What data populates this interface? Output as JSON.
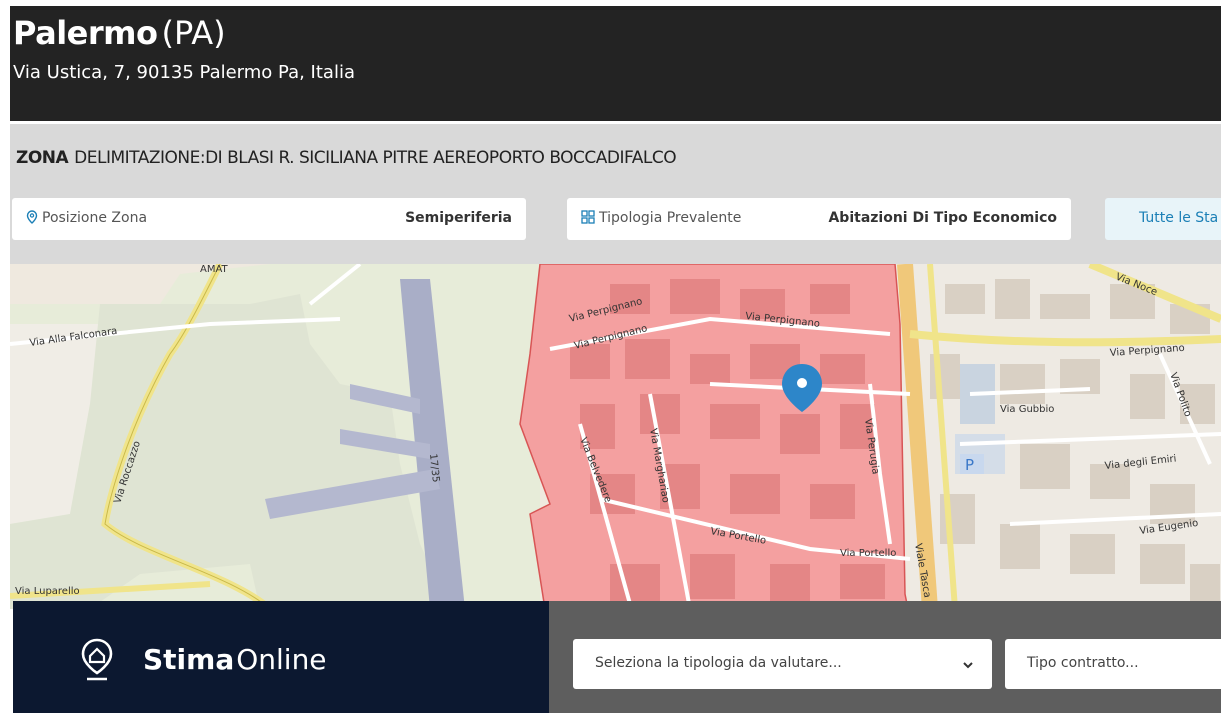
{
  "header": {
    "city": "Palermo",
    "province": "(PA)",
    "address": "Via Ustica, 7, 90135 Palermo Pa, Italia"
  },
  "zone": {
    "label": "ZONA",
    "description": "DELIMITAZIONE:DI BLASI R. SICILIANA PITRE AEREOPORTO BOCCADIFALCO",
    "position": {
      "label": "Posizione Zona",
      "value": "Semiperiferia",
      "icon": "map-pin-icon"
    },
    "typology": {
      "label": "Tipologia Prevalente",
      "value": "Abitazioni Di Tipo Economico",
      "icon": "grid-icon"
    },
    "all_stats_button": "Tutte le Sta"
  },
  "map": {
    "streets": [
      "Via Alla Falconara",
      "Via Roccazzo",
      "Via Luparello",
      "Via Perpignano",
      "Via Perpignano",
      "Via Perpignano",
      "Via Belvedere",
      "Via Marghariao",
      "Via Portello",
      "Via Portello",
      "Via Perpignano",
      "Via Gubbio",
      "Via degli Emiri",
      "Via Eugenio",
      "Viale Tasca",
      "Via Noce",
      "Via Polito",
      "Via Perugia",
      "AMAT",
      "17/35"
    ],
    "zone_highlight_color": "#f4a0a0",
    "marker_color": "#2d86c9",
    "parking_label": "P"
  },
  "stima": {
    "bold": "Stima",
    "light": "Online",
    "icon": "home-pin-icon"
  },
  "form": {
    "tipologia_placeholder": "Seleziona la tipologia da valutare...",
    "contratto_placeholder": "Tipo contratto..."
  }
}
